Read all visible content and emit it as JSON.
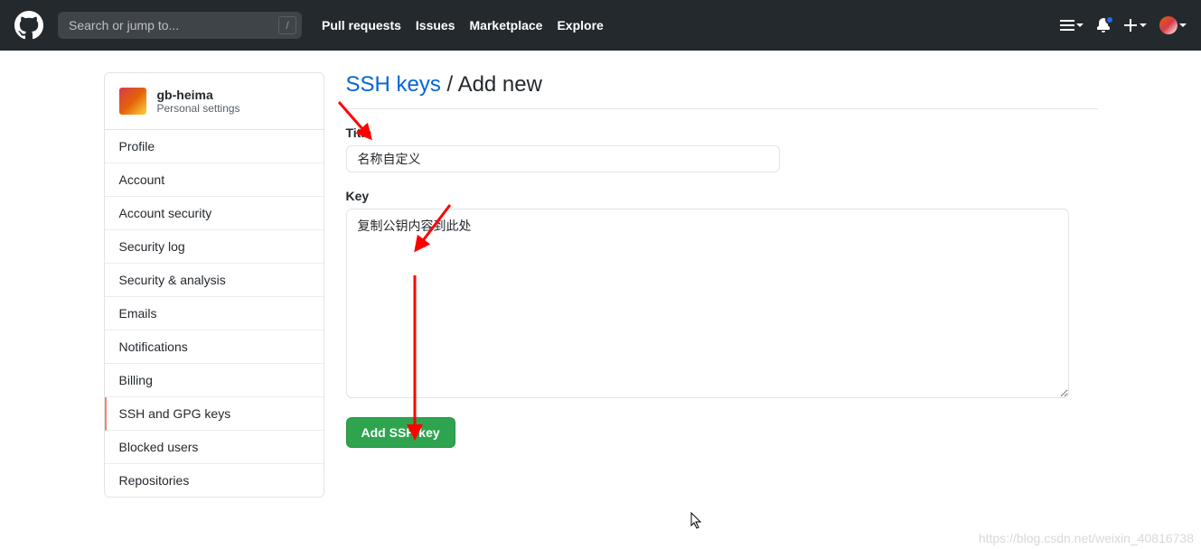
{
  "header": {
    "search_placeholder": "Search or jump to...",
    "slash_key": "/",
    "nav": [
      "Pull requests",
      "Issues",
      "Marketplace",
      "Explore"
    ]
  },
  "sidebar": {
    "username": "gb-heima",
    "subtitle": "Personal settings",
    "items": [
      {
        "label": "Profile",
        "active": false
      },
      {
        "label": "Account",
        "active": false
      },
      {
        "label": "Account security",
        "active": false
      },
      {
        "label": "Security log",
        "active": false
      },
      {
        "label": "Security & analysis",
        "active": false
      },
      {
        "label": "Emails",
        "active": false
      },
      {
        "label": "Notifications",
        "active": false
      },
      {
        "label": "Billing",
        "active": false
      },
      {
        "label": "SSH and GPG keys",
        "active": true
      },
      {
        "label": "Blocked users",
        "active": false
      },
      {
        "label": "Repositories",
        "active": false
      }
    ]
  },
  "page": {
    "title_link": "SSH keys",
    "title_separator": " / ",
    "title_rest": "Add new"
  },
  "form": {
    "title_label": "Title",
    "title_value": "名称自定义",
    "key_label": "Key",
    "key_value": "复制公钥内容到此处",
    "submit_label": "Add SSH key"
  },
  "watermark": "https://blog.csdn.net/weixin_40816738"
}
